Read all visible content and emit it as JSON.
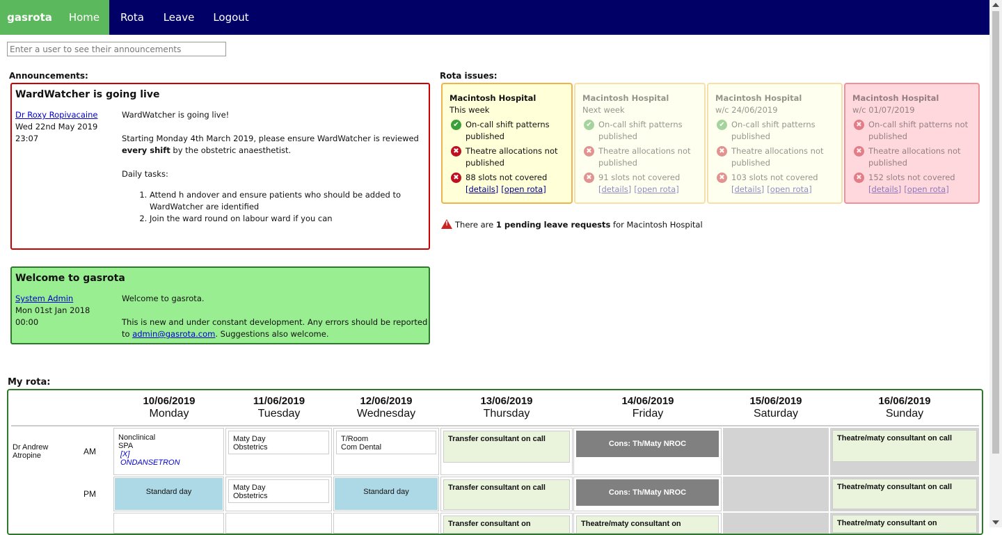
{
  "nav": {
    "brand": "gasrota",
    "home": "Home",
    "rota": "Rota",
    "leave": "Leave",
    "logout": "Logout"
  },
  "search": {
    "placeholder": "Enter a user to see their announcements"
  },
  "announcements": {
    "label": "Announcements:",
    "items": [
      {
        "title": "WardWatcher is going live",
        "author": "Dr Roxy Ropivacaine",
        "date": "Wed 22nd May 2019",
        "time": "23:07",
        "intro": "WardWatcher is going live!",
        "para_before": "Starting Monday 4th March 2019, please ensure WardWatcher is reviewed ",
        "para_bold": "every shift",
        "para_after": " by the obstetric anaesthetist.",
        "tasks_heading": "Daily tasks:",
        "tasks": [
          "Attend h andover and ensure patients who should be added to WardWatcher are identified",
          "Join the ward round on labour ward if you can"
        ]
      },
      {
        "title": "Welcome to gasrota",
        "author": "System Admin",
        "date": "Mon 01st Jan 2018",
        "time": "00:00",
        "line1": "Welcome to gasrota.",
        "line2_before": "This is new and under constant development. Any errors should be reported to ",
        "email": "admin@gasrota.com",
        "line2_after": ". Suggestions also welcome."
      }
    ]
  },
  "rota_issues": {
    "label": "Rota issues:",
    "links": {
      "details": "[details]",
      "open": "[open rota]"
    },
    "cards": [
      {
        "hospital": "Macintosh Hospital",
        "week": "This week",
        "shift": "On-call shift patterns published",
        "theatre": "Theatre allocations not published",
        "slots": "88 slots not covered",
        "border": "#f0b24a",
        "bg": "#ffffd8",
        "shift_ok": true
      },
      {
        "hospital": "Macintosh Hospital",
        "week": "Next week",
        "shift": "On-call shift patterns published",
        "theatre": "Theatre allocations not published",
        "slots": "91 slots not covered",
        "border": "#f7dfa8",
        "bg": "#fffff0",
        "shift_ok": true
      },
      {
        "hospital": "Macintosh Hospital",
        "week": "w/c 24/06/2019",
        "shift": "On-call shift patterns published",
        "theatre": "Theatre allocations not published",
        "slots": "103 slots not covered",
        "border": "#f7dfa8",
        "bg": "#fffff0",
        "shift_ok": true
      },
      {
        "hospital": "Macintosh Hospital",
        "week": "w/c 01/07/2019",
        "shift": "On-call shift patterns not published",
        "theatre": "Theatre allocations not published",
        "slots": "152 slots not covered",
        "border": "#f09098",
        "bg": "#ffd8de",
        "shift_ok": false
      }
    ]
  },
  "leave_note": {
    "before": "There are ",
    "bold": "1 pending leave requests",
    "after": " for Macintosh Hospital"
  },
  "my_rota": {
    "label": "My rota:",
    "person": "Dr Andrew Atropine",
    "am": "AM",
    "pm": "PM",
    "days": [
      {
        "date": "10/06/2019",
        "name": "Monday"
      },
      {
        "date": "11/06/2019",
        "name": "Tuesday"
      },
      {
        "date": "12/06/2019",
        "name": "Wednesday"
      },
      {
        "date": "13/06/2019",
        "name": "Thursday"
      },
      {
        "date": "14/06/2019",
        "name": "Friday"
      },
      {
        "date": "15/06/2019",
        "name": "Saturday"
      },
      {
        "date": "16/06/2019",
        "name": "Sunday"
      }
    ],
    "am_row": {
      "mon_1": "Nonclinical",
      "mon_2": "SPA",
      "mon_3": "[X]",
      "mon_4": "ONDANSETRON",
      "tue_1": "Maty Day",
      "tue_2": "Obstetrics",
      "wed_1": "T/Room",
      "wed_2": "Com Dental",
      "thu": "Transfer consultant on call",
      "fri": "Cons: Th/Maty NROC",
      "sun": "Theatre/maty consultant on call"
    },
    "pm_row": {
      "mon": "Standard day",
      "tue_1": "Maty Day",
      "tue_2": "Obstetrics",
      "wed": "Standard day",
      "thu": "Transfer consultant on call",
      "fri": "Cons: Th/Maty NROC",
      "sun": "Theatre/maty consultant on call"
    },
    "row3": {
      "thu": "Transfer consultant on",
      "fri": "Theatre/maty consultant on",
      "sun": "Theatre/maty consultant on"
    }
  }
}
